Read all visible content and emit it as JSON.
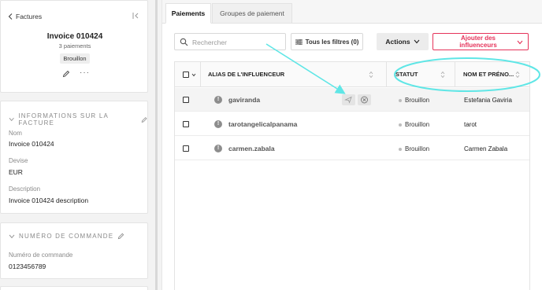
{
  "sidebar": {
    "back_label": "Factures",
    "invoice_title": "Invoice 010424",
    "payment_count": "3 paiements",
    "status_badge": "Brouillon",
    "more_label": "···",
    "info_section": {
      "heading": "INFORMATIONS SUR LA FACTURE",
      "fields": [
        {
          "label": "Nom",
          "value": "Invoice 010424"
        },
        {
          "label": "Devise",
          "value": "EUR"
        },
        {
          "label": "Description",
          "value": "Invoice 010424 description"
        }
      ]
    },
    "order_section": {
      "heading": "NUMÉRO DE COMMANDE",
      "label": "Numéro de commande",
      "value": "0123456789"
    }
  },
  "tabs": [
    {
      "label": "Paiements",
      "active": true
    },
    {
      "label": "Groupes de paiement",
      "active": false
    }
  ],
  "toolbar": {
    "search_placeholder": "Rechercher",
    "filters_label": "Tous les filtres (0)",
    "actions_label": "Actions",
    "add_label_line1": "Ajouter des",
    "add_label_line2": "influenceurs"
  },
  "table": {
    "columns": [
      "ALIAS DE L'INFLUENCEUR",
      "STATUT",
      "NOM ET PRÉNO..."
    ],
    "rows": [
      {
        "avatar": "!",
        "alias": "gaviranda",
        "status": "Brouillon",
        "name": "Estefania Gaviria"
      },
      {
        "avatar": "!",
        "alias": "tarotangelicalpanama",
        "status": "Brouillon",
        "name": "tarot"
      },
      {
        "avatar": "!",
        "alias": "carmen.zabala",
        "status": "Brouillon",
        "name": "Carmen Zabala"
      }
    ]
  },
  "colors": {
    "accent": "#e5335a",
    "highlight_annotation": "#5fe6e6",
    "status_dot": "#bdbdbd"
  },
  "icons": [
    "chevron-left-icon",
    "collapse-sidebar-icon",
    "pencil-icon",
    "chevron-down-icon",
    "search-icon",
    "filter-icon",
    "sort-icon",
    "send-icon",
    "cancel-icon"
  ]
}
